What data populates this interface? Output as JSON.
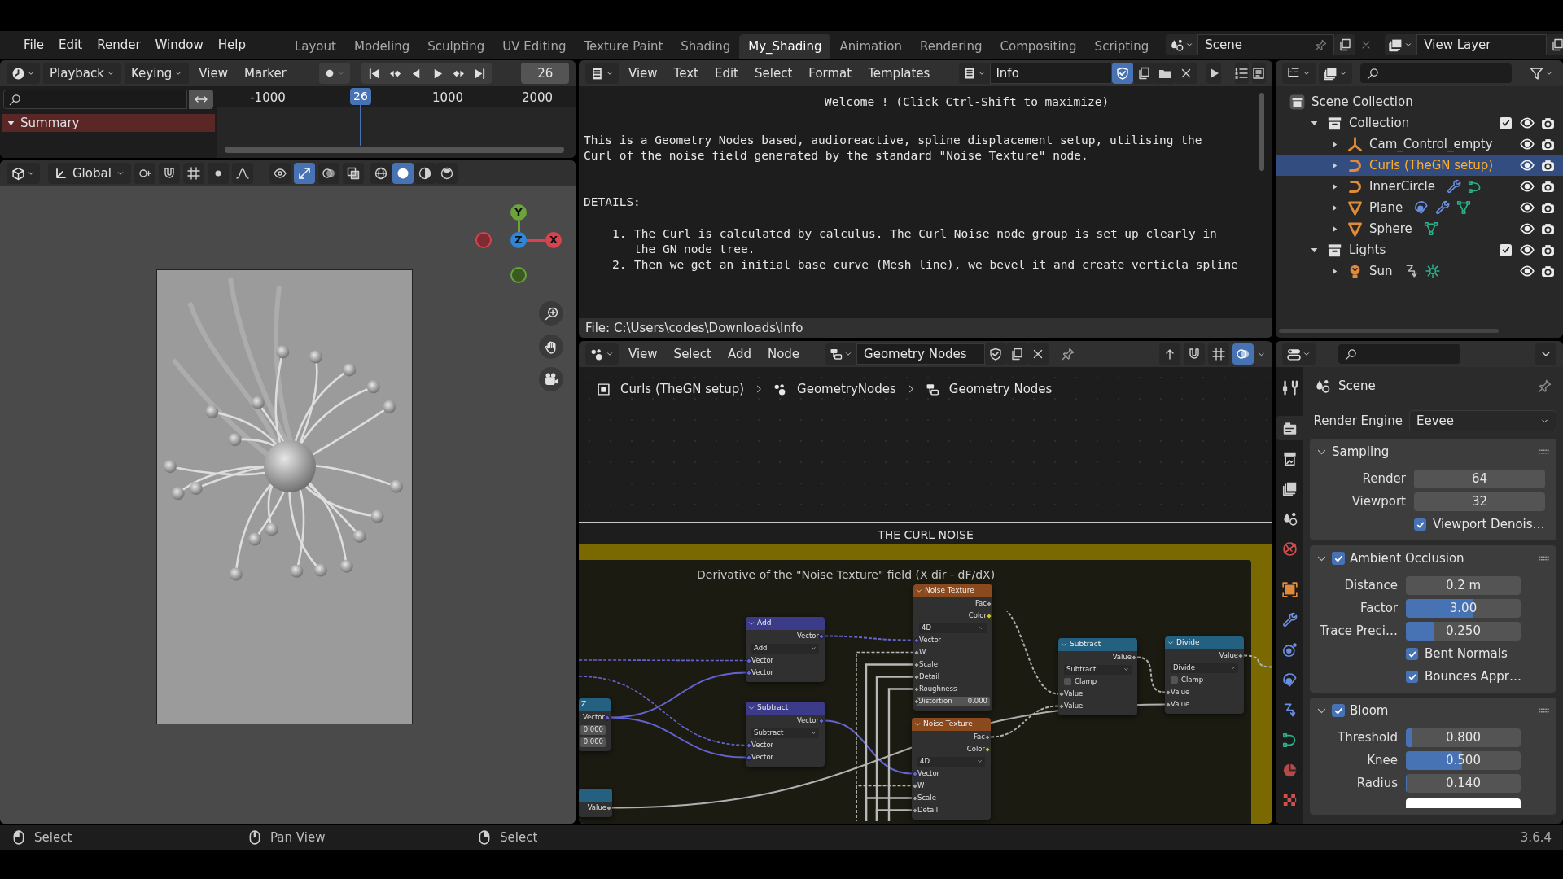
{
  "topbar": {
    "menus": [
      "File",
      "Edit",
      "Render",
      "Window",
      "Help"
    ],
    "workspaces": [
      {
        "label": "Layout",
        "selected": false
      },
      {
        "label": "Modeling",
        "selected": false
      },
      {
        "label": "Sculpting",
        "selected": false
      },
      {
        "label": "UV Editing",
        "selected": false
      },
      {
        "label": "Texture Paint",
        "selected": false
      },
      {
        "label": "Shading",
        "selected": false
      },
      {
        "label": "My_Shading",
        "selected": true
      },
      {
        "label": "Animation",
        "selected": false
      },
      {
        "label": "Rendering",
        "selected": false
      },
      {
        "label": "Compositing",
        "selected": false
      },
      {
        "label": "Scripting",
        "selected": false
      }
    ],
    "scene": "Scene",
    "view_layer": "View Layer"
  },
  "timeline": {
    "menus": [
      {
        "label": "Playback",
        "dropdown": true
      },
      {
        "label": "Keying",
        "dropdown": true
      },
      {
        "label": "View",
        "dropdown": false
      },
      {
        "label": "Marker",
        "dropdown": false
      }
    ],
    "current_frame": "26",
    "ruler": [
      "-1000",
      "1000",
      "2000"
    ],
    "playhead": "26",
    "channels": [
      {
        "label": "Summary",
        "expanded": true
      }
    ]
  },
  "viewport": {
    "orientation": "Global",
    "toggles": [
      {
        "kind": "visibility",
        "on": false
      },
      {
        "kind": "gizmo",
        "on": true
      },
      {
        "kind": "overlay",
        "on": false
      },
      {
        "kind": "xray",
        "on": false
      }
    ],
    "shading": [
      {
        "kind": "wireframe",
        "selected": false
      },
      {
        "kind": "solid",
        "selected": true
      },
      {
        "kind": "material",
        "selected": false
      },
      {
        "kind": "rendered",
        "selected": false
      }
    ],
    "gizmo": {
      "x": "X",
      "y": "Y",
      "z": "Z"
    }
  },
  "text_editor": {
    "menus": [
      "View",
      "Text",
      "Edit",
      "Select",
      "Format",
      "Templates"
    ],
    "text_block": "Info",
    "trusted": true,
    "welcome": "Welcome ! (Click Ctrl-Shift to maximize)",
    "paragraph": [
      "This is a Geometry Nodes based, audioreactive, spline displacement setup, utilising the",
      "Curl of the noise field generated by the standard \"Noise Texture\" node."
    ],
    "heading": "DETAILS:",
    "items": [
      {
        "number": "1.",
        "lines": [
          "The Curl is calculated by calculus. The Curl Noise node group is set up clearly in",
          "the GN node tree."
        ]
      },
      {
        "number": "2.",
        "lines": [
          "Then we get an initial base curve (Mesh line), we bevel it and create verticla spline"
        ]
      }
    ],
    "file_path": "File: C:\\Users\\codes\\Downloads\\Info"
  },
  "node_editor": {
    "menus": [
      "View",
      "Select",
      "Add",
      "Node"
    ],
    "node_tree": "Geometry Nodes",
    "overlay_on": true,
    "breadcrumbs": [
      "Curls (TheGN setup)",
      "GeometryNodes",
      "Geometry Nodes"
    ],
    "frame_label": "THE CURL NOISE",
    "inner_frame_label": "Derivative of the \"Noise Texture\" field (X dir - dF/dX)",
    "nodes": [
      {
        "title": "Z",
        "kind": "converter",
        "rows": [
          {
            "kind": "output",
            "label": "Vector",
            "color": "#6464d0"
          },
          {
            "kind": "field",
            "value": "0.000"
          },
          {
            "kind": "field",
            "value": "0.000"
          }
        ]
      },
      {
        "kind": "converter",
        "rows": [
          {
            "kind": "output",
            "label": "Value",
            "color": "#a1a1a1"
          }
        ]
      },
      {
        "title": "Add",
        "kind": "vector_math",
        "rows": [
          {
            "kind": "output",
            "label": "Vector",
            "color": "#6464d0"
          },
          {
            "kind": "dropdown",
            "label": "Add"
          },
          {
            "kind": "input",
            "label": "Vector",
            "color": "#6464d0"
          },
          {
            "kind": "input",
            "label": "Vector",
            "color": "#6464d0"
          }
        ]
      },
      {
        "title": "Subtract",
        "kind": "vector_math",
        "rows": [
          {
            "kind": "output",
            "label": "Vector",
            "color": "#6464d0"
          },
          {
            "kind": "dropdown",
            "label": "Subtract"
          },
          {
            "kind": "input",
            "label": "Vector",
            "color": "#6464d0"
          },
          {
            "kind": "input",
            "label": "Vector",
            "color": "#6464d0"
          }
        ]
      },
      {
        "title": "Noise Texture",
        "kind": "texture",
        "rows": [
          {
            "kind": "output",
            "label": "Fac",
            "color": "#a1a1a1"
          },
          {
            "kind": "output",
            "label": "Color",
            "color": "#c7c729"
          },
          {
            "kind": "dropdown",
            "label": "4D"
          },
          {
            "kind": "input",
            "label": "Vector",
            "color": "#6464d0"
          },
          {
            "kind": "input",
            "label": "W",
            "color": "#a1a1a1"
          },
          {
            "kind": "input",
            "label": "Scale",
            "color": "#a1a1a1"
          },
          {
            "kind": "input",
            "label": "Detail",
            "color": "#a1a1a1"
          },
          {
            "kind": "input",
            "label": "Roughness",
            "color": "#a1a1a1"
          },
          {
            "kind": "field",
            "label": "Distortion",
            "value": "0.000",
            "color": "#a1a1a1"
          }
        ]
      },
      {
        "title": "Noise Texture",
        "kind": "texture",
        "rows": [
          {
            "kind": "output",
            "label": "Fac",
            "color": "#a1a1a1"
          },
          {
            "kind": "output",
            "label": "Color",
            "color": "#c7c729"
          },
          {
            "kind": "dropdown",
            "label": "4D"
          },
          {
            "kind": "input",
            "label": "Vector",
            "color": "#6464d0"
          },
          {
            "kind": "input",
            "label": "W",
            "color": "#a1a1a1"
          },
          {
            "kind": "input",
            "label": "Scale",
            "color": "#a1a1a1"
          },
          {
            "kind": "input",
            "label": "Detail",
            "color": "#a1a1a1"
          }
        ]
      },
      {
        "title": "Subtract",
        "kind": "math",
        "rows": [
          {
            "kind": "output",
            "label": "Value",
            "color": "#a1a1a1"
          },
          {
            "kind": "dropdown",
            "label": "Subtract"
          },
          {
            "kind": "checkbox",
            "label": "Clamp",
            "checked": false
          },
          {
            "kind": "input",
            "label": "Value",
            "color": "#a1a1a1"
          },
          {
            "kind": "input",
            "label": "Value",
            "color": "#a1a1a1"
          }
        ]
      },
      {
        "title": "Divide",
        "kind": "math",
        "rows": [
          {
            "kind": "output",
            "label": "Value",
            "color": "#a1a1a1"
          },
          {
            "kind": "dropdown",
            "label": "Divide"
          },
          {
            "kind": "checkbox",
            "label": "Clamp",
            "checked": false
          },
          {
            "kind": "input",
            "label": "Value",
            "color": "#a1a1a1"
          },
          {
            "kind": "input",
            "label": "Value",
            "color": "#a1a1a1"
          }
        ]
      }
    ]
  },
  "outliner": {
    "tree": [
      {
        "label": "Scene Collection",
        "kind": "scene_collection",
        "selected": false,
        "children": [
          {
            "label": "Collection",
            "kind": "collection",
            "expanded": true,
            "checked": true,
            "selected": false,
            "children": [
              {
                "label": "Cam_Control_empty",
                "kind": "empty",
                "expanded": false,
                "selected": false
              },
              {
                "label": "Curls (TheGN setup)",
                "kind": "curve",
                "expanded": false,
                "selected": true
              },
              {
                "label": "InnerCircle",
                "kind": "curve",
                "expanded": false,
                "selected": false,
                "data_icons": [
                  {
                    "kind": "wrench"
                  },
                  {
                    "kind": "curve_data"
                  }
                ]
              },
              {
                "label": "Plane",
                "kind": "mesh",
                "expanded": false,
                "selected": false,
                "data_icons": [
                  {
                    "kind": "particles"
                  },
                  {
                    "kind": "wrench"
                  },
                  {
                    "kind": "mesh_data"
                  }
                ]
              },
              {
                "label": "Sphere",
                "kind": "mesh",
                "expanded": false,
                "selected": false,
                "data_icons": [
                  {
                    "kind": "mesh_data"
                  }
                ]
              }
            ]
          },
          {
            "label": "Lights",
            "kind": "collection",
            "expanded": true,
            "checked": true,
            "selected": false,
            "children": [
              {
                "label": "Sun",
                "kind": "light",
                "expanded": false,
                "selected": false,
                "data_icons": [
                  {
                    "kind": "hook"
                  },
                  {
                    "kind": "sun"
                  }
                ]
              }
            ]
          }
        ]
      }
    ]
  },
  "properties": {
    "tabs": [
      {
        "kind": "tool",
        "selected": false
      },
      {
        "kind": "render",
        "selected": true
      },
      {
        "kind": "output",
        "selected": false
      },
      {
        "kind": "view_layer",
        "selected": false
      },
      {
        "kind": "scene",
        "selected": false
      },
      {
        "kind": "world",
        "selected": false
      },
      {
        "kind": "object",
        "selected": false
      },
      {
        "kind": "modifiers",
        "selected": false
      },
      {
        "kind": "particles",
        "selected": false
      },
      {
        "kind": "physics",
        "selected": false
      },
      {
        "kind": "constraints",
        "selected": false
      },
      {
        "kind": "data",
        "selected": false
      },
      {
        "kind": "material",
        "selected": false
      },
      {
        "kind": "texture",
        "selected": false
      }
    ],
    "context": "Scene",
    "render_engine_label": "Render Engine",
    "render_engine": "Eevee",
    "panels": [
      {
        "title": "Sampling",
        "expanded": true,
        "rows": [
          {
            "kind": "number",
            "label": "Render",
            "value": "64"
          },
          {
            "kind": "number",
            "label": "Viewport",
            "value": "32"
          },
          {
            "kind": "checkbox",
            "label": "Viewport Denois…",
            "checked": true
          }
        ]
      },
      {
        "title": "Ambient Occlusion",
        "expanded": true,
        "checked": true,
        "rows": [
          {
            "kind": "number",
            "label": "Distance",
            "value": "0.2 m"
          },
          {
            "kind": "slider",
            "label": "Factor",
            "value": "3.00",
            "level": 0.59
          },
          {
            "kind": "slider",
            "label": "Trace Preci…",
            "value": "0.250",
            "level": 0.24
          },
          {
            "kind": "checkbox",
            "label": "Bent Normals",
            "checked": true
          },
          {
            "kind": "checkbox",
            "label": "Bounces Appr…",
            "checked": true
          }
        ]
      },
      {
        "title": "Bloom",
        "expanded": true,
        "checked": true,
        "rows": [
          {
            "kind": "slider",
            "label": "Threshold",
            "value": "0.800",
            "level": 0.06
          },
          {
            "kind": "slider",
            "label": "Knee",
            "value": "0.500",
            "level": 0.49
          },
          {
            "kind": "slider",
            "label": "Radius",
            "value": "0.140",
            "level": 0.01
          },
          {
            "kind": "color"
          }
        ]
      }
    ]
  },
  "status_bar": {
    "hints": [
      {
        "label": "Select",
        "kind": "left"
      },
      {
        "label": "Pan View",
        "kind": "middle"
      },
      {
        "label": "Select",
        "kind": "right"
      }
    ],
    "version": "3.6.4"
  }
}
